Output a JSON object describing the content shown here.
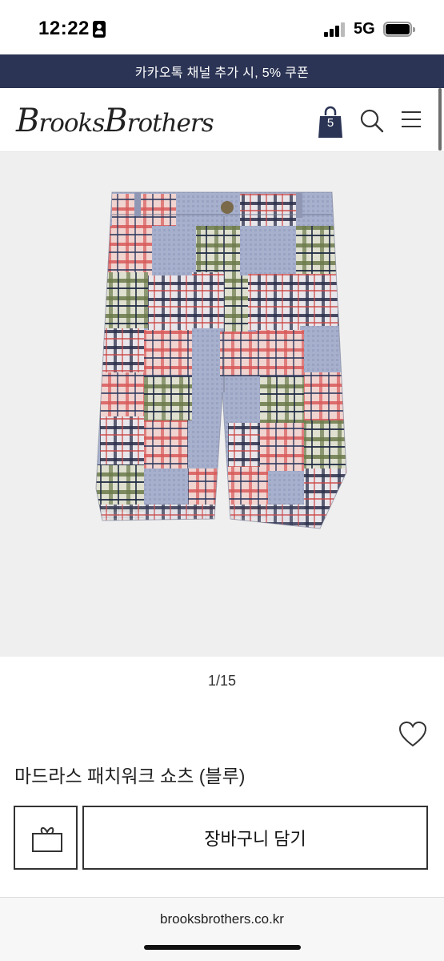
{
  "status_bar": {
    "time": "12:22",
    "network": "5G",
    "icons": [
      "id-card-icon",
      "signal-icon",
      "battery-icon"
    ]
  },
  "promo_banner": {
    "text": "카카오톡 채널 추가 시, 5% 쿠폰"
  },
  "header": {
    "logo_text": "Brooks Brothers",
    "cart_count": "5",
    "icons": [
      "shopping-bag-icon",
      "search-icon",
      "menu-icon"
    ]
  },
  "product": {
    "image_alt": "madras patchwork shorts",
    "pager": "1/15",
    "name": "마드라스 패치워크 쇼츠 (블루)",
    "wishlist_icon": "heart-icon"
  },
  "actions": {
    "gift_icon": "gift-box-icon",
    "add_to_cart_label": "장바구니 담기"
  },
  "browser": {
    "url": "brooksbrothers.co.kr"
  },
  "colors": {
    "banner_bg": "#2b3454",
    "bag_color": "#2b3454",
    "image_bg": "#efefef"
  }
}
